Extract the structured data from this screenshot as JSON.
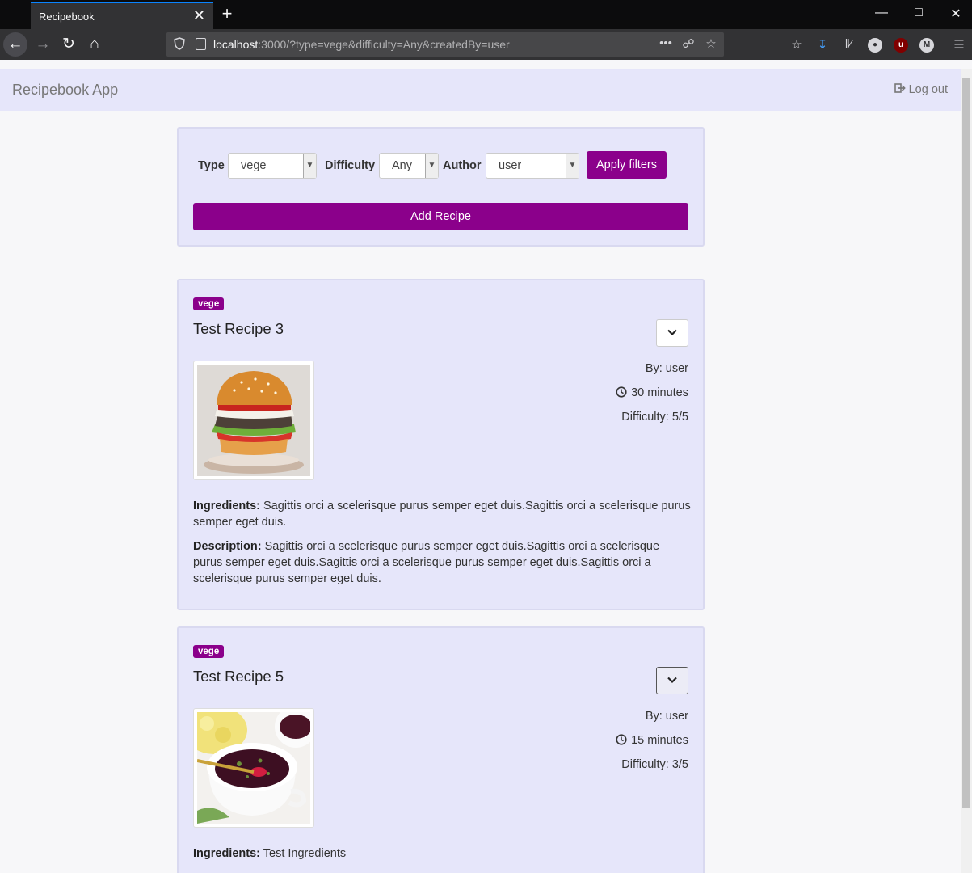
{
  "browser": {
    "tab_title": "Recipebook",
    "tab_close": "✕",
    "new_tab": "+",
    "url_host": "localhost",
    "url_rest": ":3000/?type=vege&difficulty=Any&createdBy=user",
    "url_more": "•••"
  },
  "app": {
    "brand": "Recipebook App",
    "logout_label": "Log out"
  },
  "filters": {
    "type_label": "Type",
    "type_value": "vege",
    "difficulty_label": "Difficulty",
    "difficulty_value": "Any",
    "author_label": "Author",
    "author_value": "user",
    "apply_label": "Apply filters",
    "add_label": "Add Recipe"
  },
  "recipes": [
    {
      "badge": "vege",
      "title": "Test Recipe 3",
      "author": "By: user",
      "time": "30 minutes",
      "difficulty": "Difficulty: 5/5",
      "ingredients_label": "Ingredients:",
      "ingredients": "Sagittis orci a scelerisque purus semper eget duis.Sagittis orci a scelerisque purus semper eget duis.",
      "description_label": "Description:",
      "description": "Sagittis orci a scelerisque purus semper eget duis.Sagittis orci a scelerisque purus semper eget duis.Sagittis orci a scelerisque purus semper eget duis.Sagittis orci a scelerisque purus semper eget duis.",
      "image_icon": "burger-photo"
    },
    {
      "badge": "vege",
      "title": "Test Recipe 5",
      "author": "By: user",
      "time": "15 minutes",
      "difficulty": "Difficulty: 3/5",
      "ingredients_label": "Ingredients:",
      "ingredients": "Test Ingredients",
      "image_icon": "beet-soup-photo"
    }
  ],
  "colors": {
    "accent": "#8b008b",
    "navbar_bg": "#e6e6fa",
    "page_bg": "#f7f7f9"
  }
}
